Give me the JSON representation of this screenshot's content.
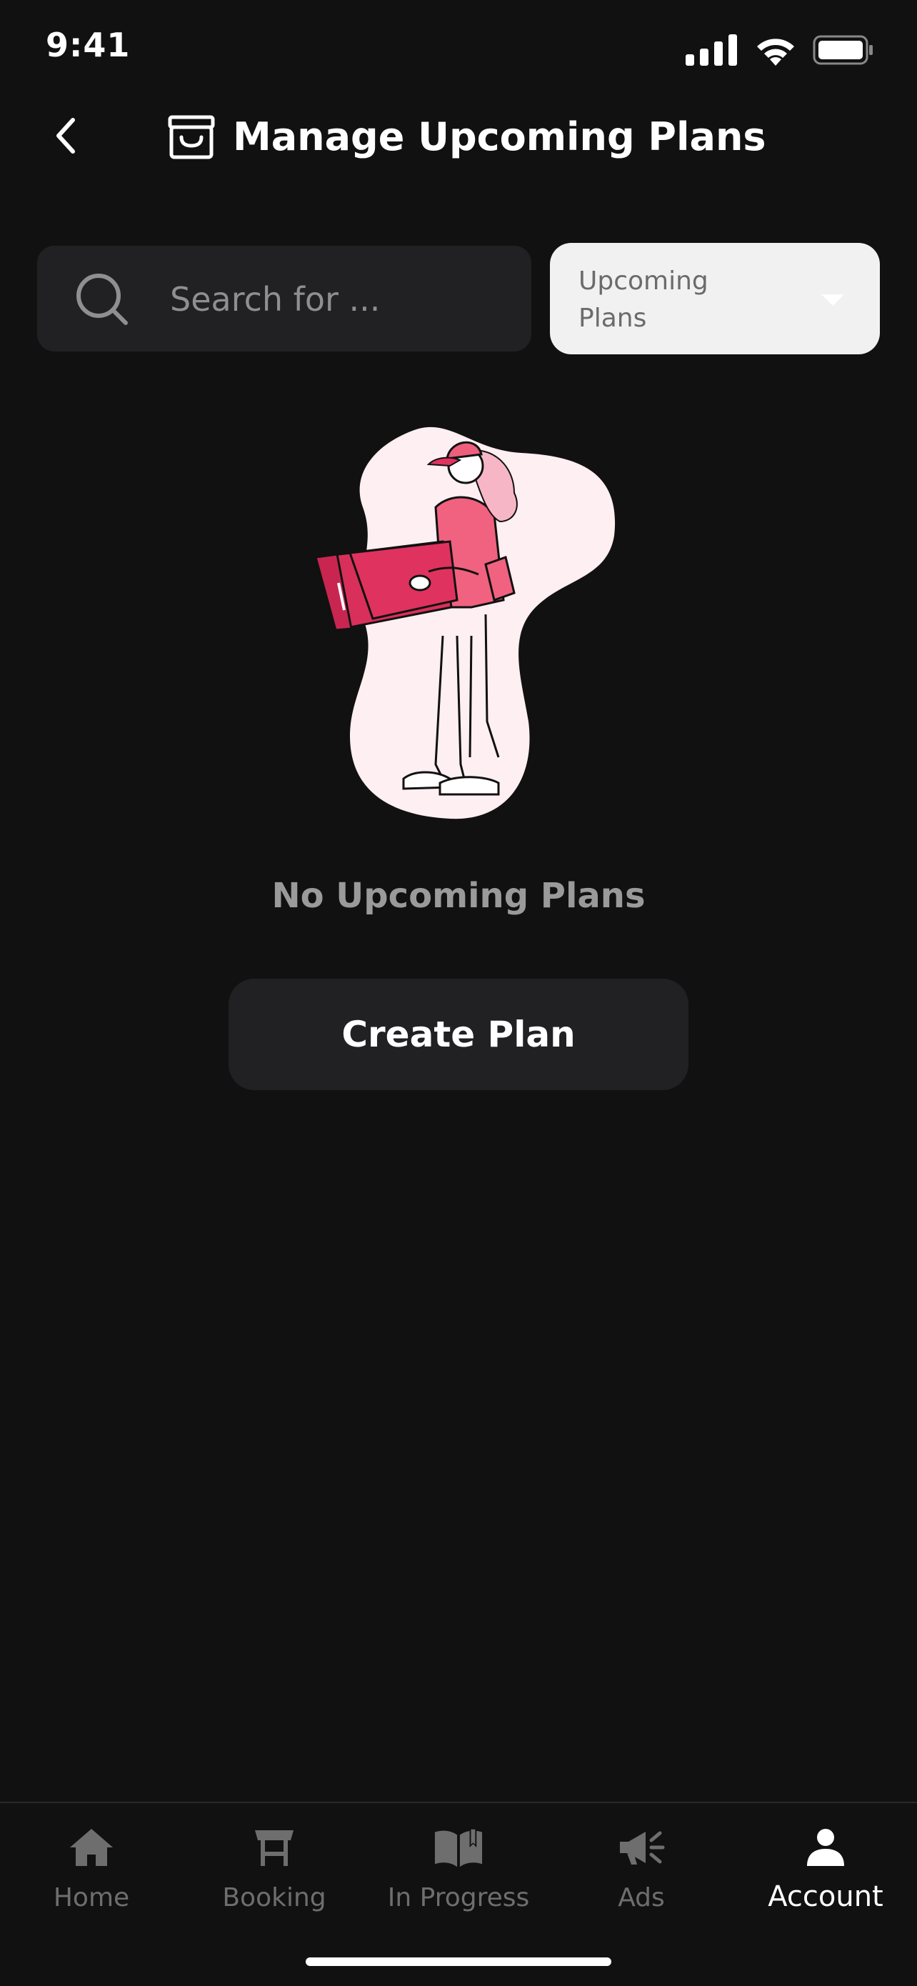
{
  "status_bar": {
    "time": "9:41"
  },
  "header": {
    "title": "Manage Upcoming Plans",
    "icon": "archive-box-icon"
  },
  "search": {
    "placeholder": "Search for ..."
  },
  "filter": {
    "line1": "Upcoming",
    "line2": "Plans"
  },
  "empty_state": {
    "title": "No Upcoming Plans",
    "button_label": "Create Plan"
  },
  "tabs": [
    {
      "label": "Home",
      "icon": "home-icon",
      "active": false
    },
    {
      "label": "Booking",
      "icon": "table-icon",
      "active": false
    },
    {
      "label": "In Progress",
      "icon": "book-icon",
      "active": false
    },
    {
      "label": "Ads",
      "icon": "megaphone-icon",
      "active": false
    },
    {
      "label": "Account",
      "icon": "user-icon",
      "active": true
    }
  ],
  "colors": {
    "background": "#111111",
    "surface": "#212124",
    "dropdown_bg": "#f1f1f1",
    "accent_pink": "#e0325f",
    "inactive_tab": "#6e6e6e"
  }
}
